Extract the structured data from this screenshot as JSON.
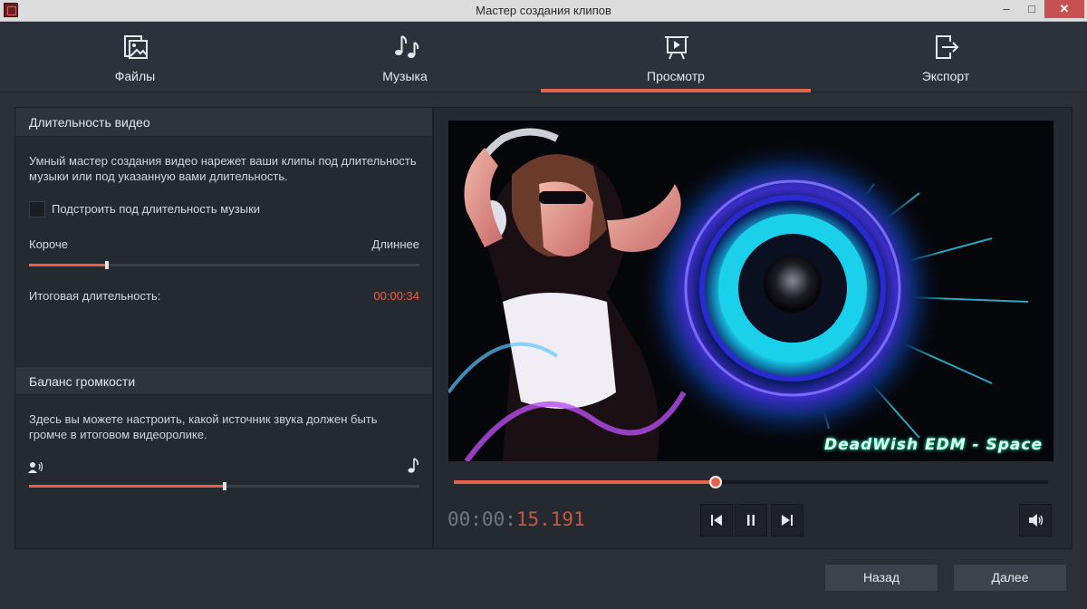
{
  "window": {
    "title": "Мастер создания клипов",
    "minimize": "–",
    "maximize": "□",
    "close": "✕"
  },
  "tabs": [
    {
      "label": "Файлы",
      "icon": "image-files-icon",
      "active": false
    },
    {
      "label": "Музыка",
      "icon": "music-notes-icon",
      "active": false
    },
    {
      "label": "Просмотр",
      "icon": "preview-play-icon",
      "active": true
    },
    {
      "label": "Экспорт",
      "icon": "export-icon",
      "active": false
    }
  ],
  "duration": {
    "heading": "Длительность видео",
    "description": "Умный мастер создания видео нарежет ваши клипы под длительность музыки или под указанную вами длительность.",
    "fit_music_label": "Подстроить под длительность музыки",
    "fit_music_checked": false,
    "shorter_label": "Короче",
    "longer_label": "Длиннее",
    "slider_fraction": 0.2,
    "total_label": "Итоговая длительность:",
    "total_value": "00:00:34"
  },
  "volume": {
    "heading": "Баланс громкости",
    "description": "Здесь вы можете настроить, какой источник звука должен быть громче в итоговом видеоролике.",
    "slider_fraction": 0.5,
    "left_icon": "voice-icon",
    "right_icon": "music-note-icon"
  },
  "player": {
    "watermark": "DeadWish EDM - Space",
    "progress_fraction": 0.44,
    "time_dim": "00:00:",
    "time_active": "15.191"
  },
  "buttons": {
    "back": "Назад",
    "next": "Далее"
  },
  "colors": {
    "accent": "#e8614a",
    "panel": "#252a31",
    "background": "#2b3038"
  }
}
